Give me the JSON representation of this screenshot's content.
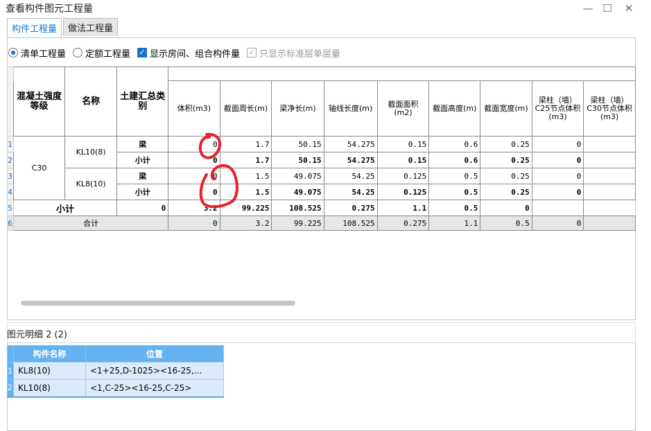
{
  "window": {
    "title": "查看构件图元工程量",
    "min_glyph": "—",
    "max_glyph": "☐",
    "close_glyph": "✕"
  },
  "tabs": [
    {
      "label": "构件工程量",
      "active": true
    },
    {
      "label": "做法工程量",
      "active": false
    }
  ],
  "options": {
    "radio_qingdan": "清单工程量",
    "radio_dinge": "定额工程量",
    "check_show_rooms": "显示房间、组合构件量",
    "check_standard_floor": "只显示标准层单层量"
  },
  "table": {
    "headers": {
      "grade": "混凝土强度等级",
      "name": "名称",
      "category": "土建汇总类别",
      "volume": "体积(m3)",
      "perimeter": "截面周长(m)",
      "net_length": "梁净长(m)",
      "axis_length": "轴线长度(m)",
      "area": "截面面积(m2)",
      "height": "截面高度(m)",
      "width": "截面宽度(m)",
      "c25": "梁柱（墙）C25节点体积(m3)",
      "c30": "梁柱（墙）C30节点体积(m3)"
    },
    "row_numbers": [
      "1",
      "2",
      "3",
      "4",
      "5",
      "6"
    ],
    "grade": "C30",
    "groups": [
      {
        "name": "KL10(8)",
        "rows": [
          {
            "category": "梁",
            "volume": "0",
            "perimeter": "1.7",
            "net_length": "50.15",
            "axis_length": "54.275",
            "area": "0.15",
            "height": "0.6",
            "width": "0.25",
            "c25": "0"
          },
          {
            "category": "小计",
            "volume": "0",
            "perimeter": "1.7",
            "net_length": "50.15",
            "axis_length": "54.275",
            "area": "0.15",
            "height": "0.6",
            "width": "0.25",
            "c25": "0"
          }
        ]
      },
      {
        "name": "KL8(10)",
        "rows": [
          {
            "category": "梁",
            "volume": "0",
            "perimeter": "1.5",
            "net_length": "49.075",
            "axis_length": "54.25",
            "area": "0.125",
            "height": "0.5",
            "width": "0.25",
            "c25": "0"
          },
          {
            "category": "小计",
            "volume": "0",
            "perimeter": "1.5",
            "net_length": "49.075",
            "axis_length": "54.25",
            "area": "0.125",
            "height": "0.5",
            "width": "0.25",
            "c25": "0"
          }
        ]
      }
    ],
    "subtotal": {
      "label": "小计",
      "volume": "0",
      "perimeter": "3.2",
      "net_length": "99.225",
      "axis_length": "108.525",
      "area": "0.275",
      "height": "1.1",
      "width": "0.5",
      "c25": "0"
    },
    "total": {
      "label": "合计",
      "volume": "0",
      "perimeter": "3.2",
      "net_length": "99.225",
      "axis_length": "108.525",
      "area": "0.275",
      "height": "1.1",
      "width": "0.5",
      "c25": "0"
    }
  },
  "detail": {
    "title": "图元明细",
    "count": "2 (2)",
    "headers": {
      "name": "构件名称",
      "position": "位置"
    },
    "rows": [
      {
        "no": "1",
        "name": "KL8(10)",
        "position": "<1+25,D-1025><16-25,..."
      },
      {
        "no": "2",
        "name": "KL10(8)",
        "position": "<1,C-25><16-25,C-25>"
      }
    ]
  },
  "colors": {
    "accent": "#1a73c6",
    "detail_header": "#66b2f0",
    "detail_row": "#dcebfa",
    "total_row": "#e6e6e6",
    "annotation": "#e8202a"
  }
}
